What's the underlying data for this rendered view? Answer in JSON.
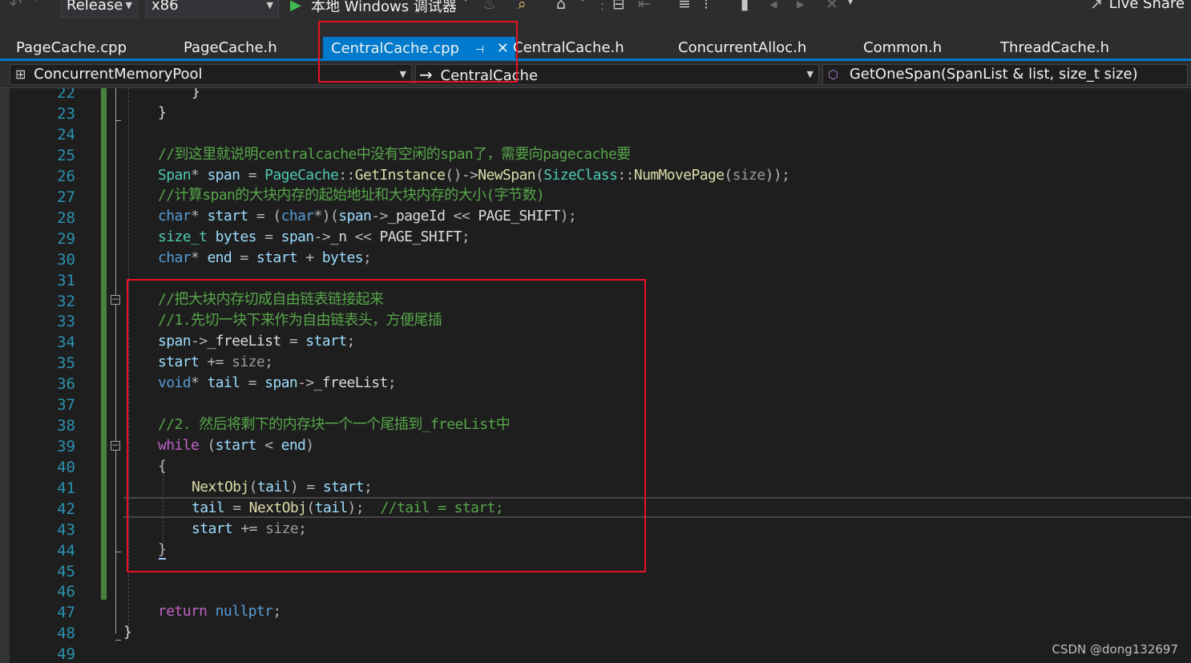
{
  "toolbar": {
    "configuration": "Release",
    "platform": "x86",
    "run_label": "本地 Windows 调试器",
    "live_share": "Live Share",
    "icons": [
      "back-icon",
      "play-icon",
      "find-in-files-icon",
      "home-icon",
      "step-icon",
      "indent-icon",
      "comment-icon",
      "bookmark-icon"
    ]
  },
  "tabs": [
    {
      "label": "PageCache.cpp",
      "active": false
    },
    {
      "label": "PageCache.h",
      "active": false
    },
    {
      "label": "CentralCache.cpp",
      "active": true
    },
    {
      "label": "CentralCache.h",
      "active": false
    },
    {
      "label": "ConcurrentAlloc.h",
      "active": false
    },
    {
      "label": "Common.h",
      "active": false
    },
    {
      "label": "ThreadCache.h",
      "active": false
    }
  ],
  "nav": {
    "project": "ConcurrentMemoryPool",
    "scope": "CentralCache",
    "member": "GetOneSpan(SpanList & list, size_t size)"
  },
  "editor": {
    "line_numbers": [
      "22",
      "23",
      "24",
      "25",
      "26",
      "27",
      "28",
      "29",
      "30",
      "31",
      "32",
      "33",
      "34",
      "35",
      "36",
      "37",
      "38",
      "39",
      "40",
      "41",
      "42",
      "43",
      "44",
      "45",
      "46",
      "47",
      "48",
      "49"
    ],
    "current_line": "42"
  },
  "code": {
    "l22": "}",
    "l23": "}",
    "l25": "//到这里就说明centralcache中没有空闲的span了，需要向pagecache要",
    "l26_type": "Span",
    "l26_var": "span",
    "l26_cls": "PageCache",
    "l26_fn": "GetInstance",
    "l26_fn2": "NewSpan",
    "l26_cls2": "SizeClass",
    "l26_fn3": "NumMovePage",
    "l26_arg": "size",
    "l27": "//计算span的大块内存的起始地址和大块内存的大小(字节数)",
    "l28_kw": "char",
    "l28_var": "start",
    "l28_cast": "char",
    "l28_obj": "span",
    "l28_mem": "_pageId",
    "l28_macro": "PAGE_SHIFT",
    "l29_type": "size_t",
    "l29_var": "bytes",
    "l29_obj": "span",
    "l29_mem": "_n",
    "l29_macro": "PAGE_SHIFT",
    "l30_kw": "char",
    "l30_var": "end",
    "l30_a": "start",
    "l30_b": "bytes",
    "l32": "//把大块内存切成自由链表链接起来",
    "l33": "//1.先切一块下来作为自由链表头，方便尾插",
    "l34_obj": "span",
    "l34_mem": "_freeList",
    "l34_var": "start",
    "l35_var": "start",
    "l35_arg": "size",
    "l36_kw": "void",
    "l36_var": "tail",
    "l36_obj": "span",
    "l36_mem": "_freeList",
    "l38": "//2. 然后将剩下的内存块一个一个尾插到_freeList中",
    "l39_kw": "while",
    "l39_a": "start",
    "l39_b": "end",
    "l40": "{",
    "l41_fn": "NextObj",
    "l41_arg": "tail",
    "l41_var": "start",
    "l42_var": "tail",
    "l42_fn": "NextObj",
    "l42_arg": "tail",
    "l42_cm": "//tail = start;",
    "l43_var": "start",
    "l43_arg": "size",
    "l44": "}",
    "l47_kw": "return",
    "l47_val": "nullptr",
    "l48": "}"
  },
  "watermark": "CSDN @dong132697",
  "colors": {
    "background": "#1e1e1e",
    "tab_active": "#007acc",
    "line_number": "#2b91af",
    "keyword": "#569cd6",
    "type": "#4ec9b0",
    "function": "#dcdcaa",
    "variable": "#9cdcfe",
    "comment": "#57a64a",
    "macro": "#bd63c5",
    "highlight_box": "#e81123"
  }
}
